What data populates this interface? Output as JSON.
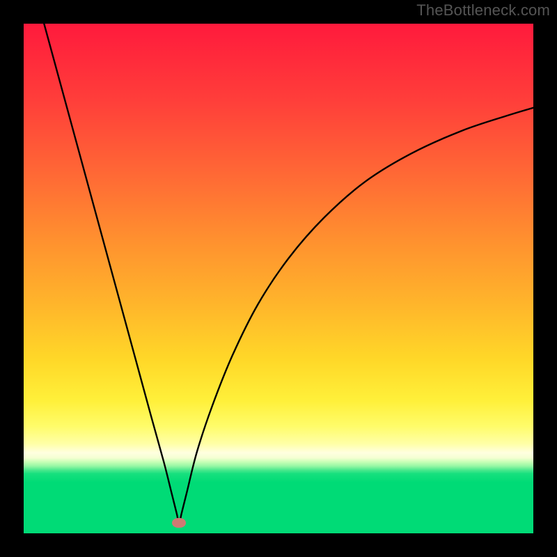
{
  "watermark": {
    "text": "TheBottleneck.com"
  },
  "chart_data": {
    "type": "line",
    "title": "",
    "xlabel": "",
    "ylabel": "",
    "xlim": [
      0,
      100
    ],
    "ylim": [
      0,
      100
    ],
    "background": "rainbow-vertical-red-to-green",
    "marker": {
      "x": 30.5,
      "y": 2.0,
      "color": "#cf7a73"
    },
    "series": [
      {
        "name": "bottleneck-curve",
        "color": "#000000",
        "x": [
          4.0,
          7.0,
          10.0,
          13.0,
          16.0,
          19.0,
          22.0,
          25.0,
          27.5,
          29.0,
          30.0,
          30.5,
          31.0,
          32.0,
          34.0,
          37.0,
          41.0,
          46.0,
          52.0,
          59.0,
          67.0,
          76.0,
          86.0,
          95.0,
          100.0
        ],
        "y": [
          100.0,
          89.0,
          78.0,
          67.0,
          56.0,
          45.0,
          34.0,
          23.0,
          14.0,
          8.0,
          4.0,
          2.0,
          4.0,
          8.0,
          16.0,
          25.0,
          35.0,
          45.0,
          54.0,
          62.0,
          69.0,
          74.5,
          79.0,
          82.0,
          83.5
        ]
      }
    ]
  }
}
